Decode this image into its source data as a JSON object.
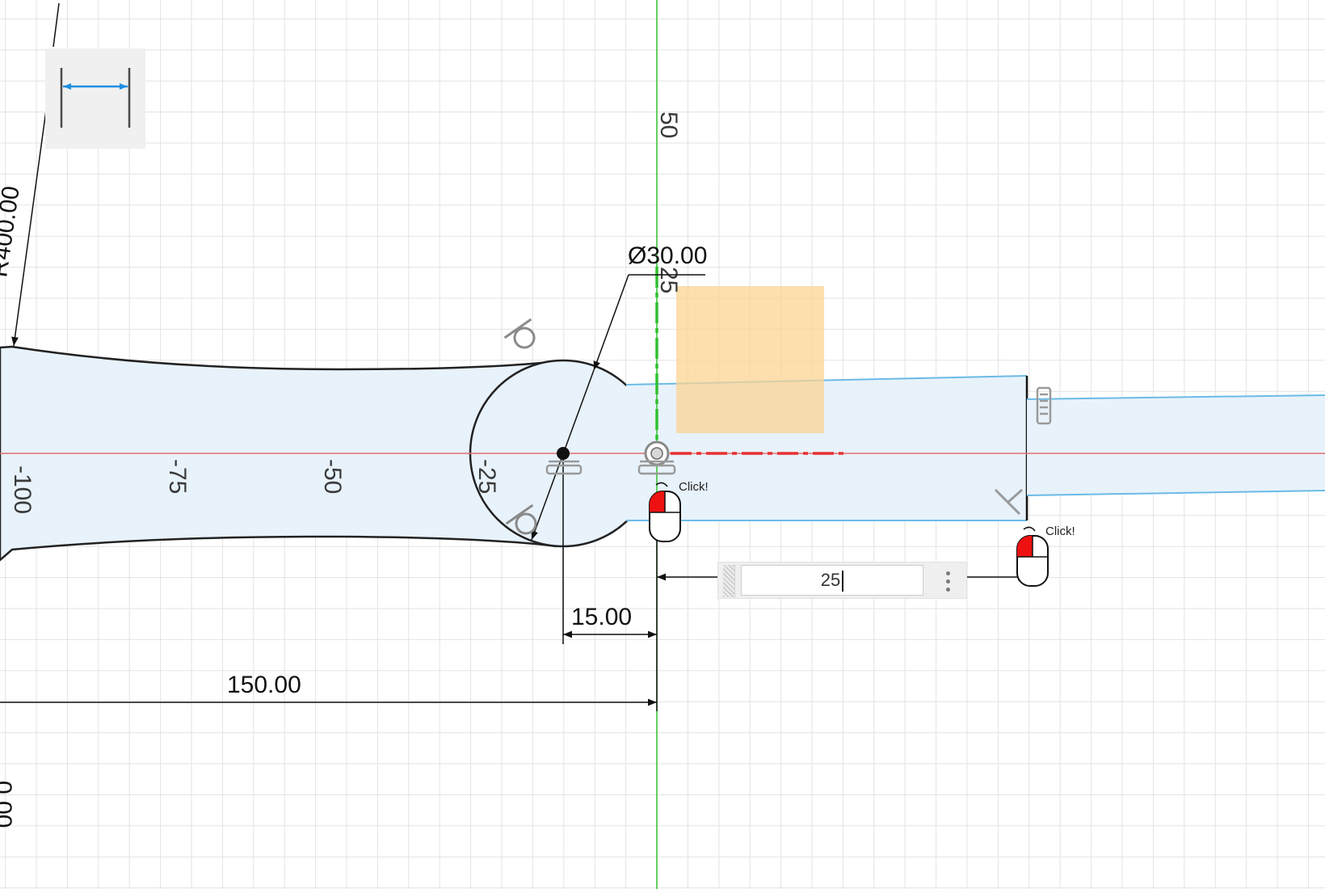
{
  "viewport": {
    "name": "sketch-canvas",
    "tool": "dimension-icon"
  },
  "axis_ticks": {
    "x": [
      "-100",
      "-75",
      "-50",
      "-25"
    ],
    "y": [
      "50",
      "25"
    ]
  },
  "dimensions": {
    "radius": "R400.00",
    "diameter": "Ø30.00",
    "offset_small": "15.00",
    "offset_large": "150.00",
    "partial_bottom": "0.00"
  },
  "dimension_input": {
    "value": "25"
  },
  "mouse_hints": {
    "first_click": "Click!",
    "second_click": "Click!"
  },
  "colors": {
    "sketch_fill": "#e8f2fb",
    "profile_line": "#222222",
    "construction_line": "#6bbbe6",
    "x_axis": "#e07070",
    "y_axis": "#2fc12f",
    "highlight": "#fbd491",
    "grid": "#e3e3e3"
  }
}
